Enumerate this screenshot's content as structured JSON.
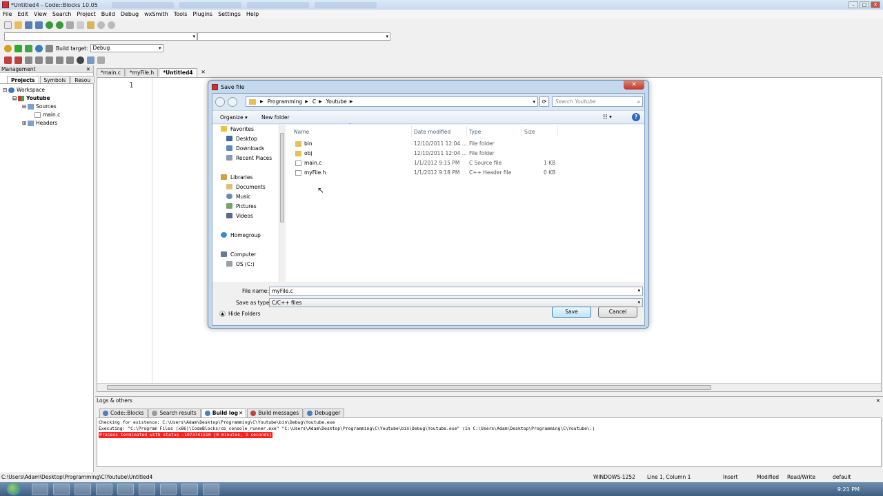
{
  "window": {
    "title": "*Untitled4 - Code::Blocks 10.05"
  },
  "menu": [
    "File",
    "Edit",
    "View",
    "Search",
    "Project",
    "Build",
    "Debug",
    "wxSmith",
    "Tools",
    "Plugins",
    "Settings",
    "Help"
  ],
  "toolbar": {
    "build_target_label": "Build target:",
    "build_target_value": "Debug"
  },
  "management": {
    "title": "Management",
    "tabs": [
      "Projects",
      "Symbols",
      "Resou"
    ],
    "tree": {
      "workspace": "Workspace",
      "project": "Youtube",
      "sources": "Sources",
      "source_file": "main.c",
      "headers": "Headers"
    }
  },
  "editor": {
    "tabs": [
      "*main.c",
      "*myFile.h",
      "*Untitled4"
    ],
    "line_number": "1"
  },
  "logs": {
    "title": "Logs & others",
    "tabs": [
      "Code::Blocks",
      "Search results",
      "Build log",
      "Build messages",
      "Debugger"
    ],
    "lines": [
      "Checking for existence: C:\\Users\\Adam\\Desktop\\Programming\\C\\Youtube\\bin\\Debug\\Youtube.exe",
      "Executing: \"C:\\Program Files (x86)\\CodeBlocks/cb_console_runner.exe\" \"C:\\Users\\Adam\\Desktop\\Programming\\C\\Youtube\\bin\\Debug\\Youtube.exe\"  (in C:\\Users\\Adam\\Desktop\\Programming\\C\\Youtube\\.)",
      "Process terminated with status -1073741510 (0 minutes, 3 seconds)"
    ]
  },
  "status": {
    "path": "C:\\Users\\Adam\\Desktop\\Programming\\C\\Youtube\\Untitled4",
    "encoding": "WINDOWS-1252",
    "position": "Line 1, Column 1",
    "mode": "Insert",
    "modified": "Modified",
    "access": "Read/Write",
    "profile": "default"
  },
  "taskbar": {
    "time": "9:21 PM"
  },
  "dialog": {
    "title": "Save file",
    "close": "✕",
    "breadcrumb": [
      "Programming",
      "C",
      "Youtube"
    ],
    "search_placeholder": "Search Youtube",
    "organize": "Organize ▾",
    "new_folder": "New folder",
    "nav": {
      "favorites": "Favorites",
      "desktop": "Desktop",
      "downloads": "Downloads",
      "recent": "Recent Places",
      "libraries": "Libraries",
      "documents": "Documents",
      "music": "Music",
      "pictures": "Pictures",
      "videos": "Videos",
      "homegroup": "Homegroup",
      "computer": "Computer",
      "os_c": "OS (C:)"
    },
    "columns": {
      "name": "Name",
      "date": "Date modified",
      "type": "Type",
      "size": "Size"
    },
    "files": [
      {
        "name": "bin",
        "date": "12/10/2011 12:04 ...",
        "type": "File folder",
        "size": ""
      },
      {
        "name": "obj",
        "date": "12/10/2011 12:04 ...",
        "type": "File folder",
        "size": ""
      },
      {
        "name": "main.c",
        "date": "1/1/2012 9:15 PM",
        "type": "C Source file",
        "size": "1 KB"
      },
      {
        "name": "myFile.h",
        "date": "1/1/2012 9:18 PM",
        "type": "C++ Header file",
        "size": "0 KB"
      }
    ],
    "file_name_label": "File name:",
    "file_name_value": "myFile.c",
    "save_type_label": "Save as type:",
    "save_type_value": "C/C++ files",
    "hide_folders": "Hide Folders",
    "save": "Save",
    "cancel": "Cancel"
  }
}
